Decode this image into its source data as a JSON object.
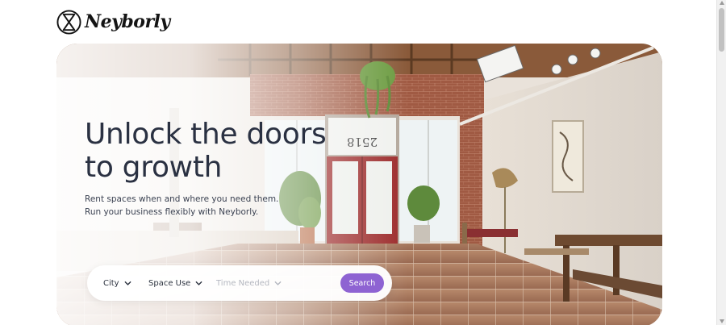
{
  "brand": {
    "name": "Neyborly"
  },
  "hero": {
    "headline_line1": "Unlock the doors",
    "headline_line2": "to growth",
    "subtext_line1": "Rent spaces when and where you need them.",
    "subtext_line2": "Run your business flexibly with Neyborly.",
    "door_sign": "2518"
  },
  "search": {
    "filters": [
      {
        "label": "City",
        "icon": "chevron-down-icon",
        "state": "active"
      },
      {
        "label": "Space Use",
        "icon": "chevron-down-icon",
        "state": "active"
      },
      {
        "label": "Time Needed",
        "icon": "chevron-down-icon",
        "state": "disabled"
      }
    ],
    "button_label": "Search"
  },
  "colors": {
    "accent": "#8e63d2",
    "headline": "#2a3142",
    "disabled_text": "#b4b7c0"
  }
}
